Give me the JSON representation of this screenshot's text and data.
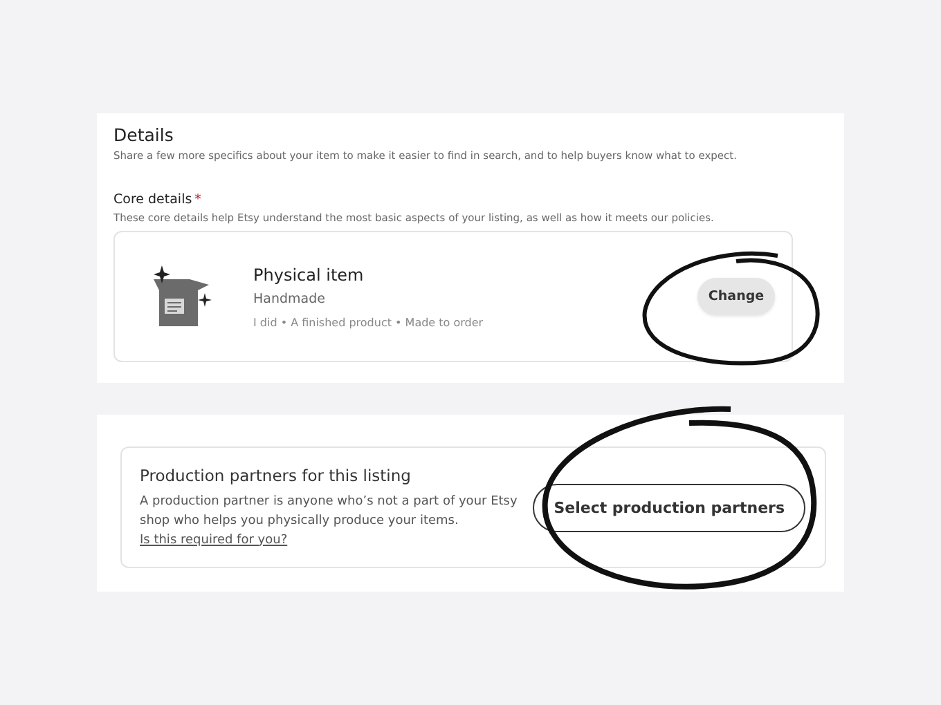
{
  "details": {
    "title": "Details",
    "subtitle": "Share a few more specifics about your item to make it easier to find in search, and to help buyers know what to expect.",
    "core": {
      "label": "Core details",
      "required_mark": "*",
      "description": "These core details help Etsy understand the most basic aspects of your listing, as well as how it meets our policies.",
      "item": {
        "title": "Physical item",
        "subtitle": "Handmade",
        "meta": "I did • A finished product • Made to order",
        "button": "Change"
      }
    }
  },
  "production": {
    "title": "Production partners for this listing",
    "description": "A production partner is anyone who’s not a part of your Etsy shop who helps you physically produce your items.",
    "link": "Is this required for you?",
    "button": "Select production partners"
  }
}
